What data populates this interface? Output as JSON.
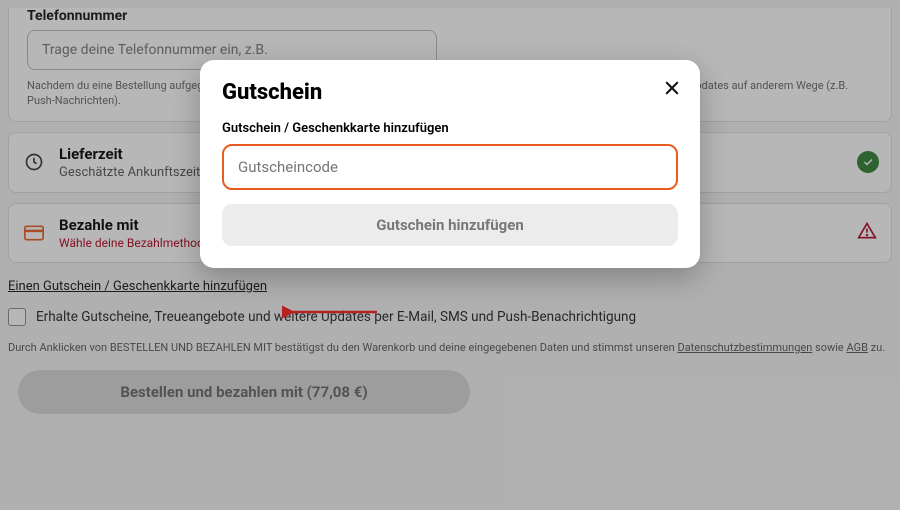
{
  "phone": {
    "label": "Telefonnummer",
    "placeholder": "Trage deine Telefonnummer ein, z.B.",
    "helper": "Nachdem du eine Bestellung aufgegeben hast, empfängst du eine Bestellbestätigung per SMS. Möglicherweise erhältst du auch Bestell-Updates auf anderem Wege (z.B. Push-Nachrichten)."
  },
  "delivery": {
    "title": "Lieferzeit",
    "sub": "Geschätzte Ankunftszeit: 80–100 Min."
  },
  "payment": {
    "title": "Bezahle mit",
    "sub": "Wähle deine Bezahlmethode"
  },
  "voucher_link": "Einen Gutschein / Geschenkkarte hinzufügen",
  "marketing": "Erhalte Gutscheine, Treueangebote und weitere Updates per E-Mail, SMS und Push-Benachrichtigung",
  "terms": {
    "prefix": "Durch Anklicken von BESTELLEN UND BEZAHLEN MIT bestätigst du den Warenkorb und deine eingegebenen Daten und stimmst unseren ",
    "privacy": "Datenschutzbestimmungen",
    "mid": " sowie ",
    "agb": "AGB",
    "suffix": " zu."
  },
  "order_button": "Bestellen und bezahlen mit (77,08 €)",
  "modal": {
    "title": "Gutschein",
    "sublabel": "Gutschein / Geschenkkarte hinzufügen",
    "placeholder": "Gutscheincode",
    "button": "Gutschein hinzufügen"
  }
}
